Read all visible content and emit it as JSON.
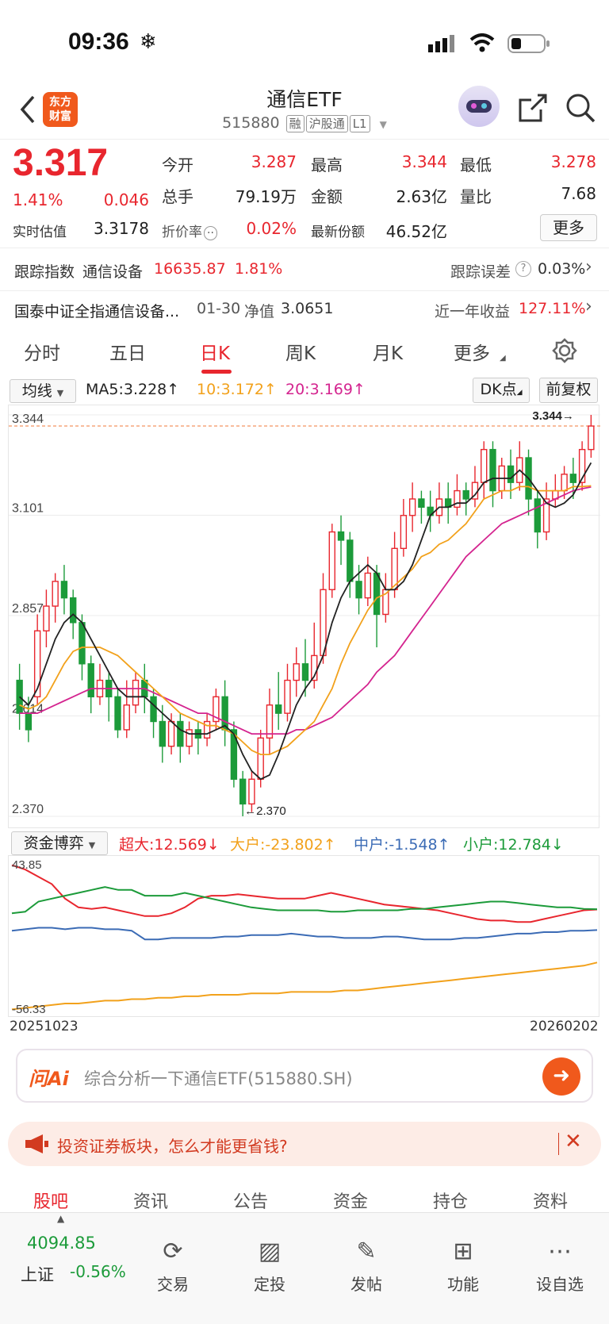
{
  "status_bar": {
    "time": "09:36"
  },
  "header": {
    "title": "通信ETF",
    "code": "515880",
    "tags": [
      "融",
      "沪股通",
      "L1"
    ],
    "logo_line1": "东方",
    "logo_line2": "财富"
  },
  "quote": {
    "price": "3.317",
    "change_pct": "1.41%",
    "change": "0.046",
    "open_label": "今开",
    "open": "3.287",
    "high_label": "最高",
    "high": "3.344",
    "low_label": "最低",
    "low": "3.278",
    "volume_label": "总手",
    "volume": "79.19万",
    "amount_label": "金额",
    "amount": "2.63亿",
    "ratio_label": "量比",
    "ratio": "7.68",
    "estimate_label": "实时估值",
    "estimate": "3.3178",
    "discount_label": "折价率",
    "discount": "0.02%",
    "shares_label": "最新份额",
    "shares": "46.52亿",
    "more_label": "更多"
  },
  "tracking": {
    "index_label": "跟踪指数",
    "index_name": "通信设备",
    "index_value": "16635.87",
    "index_change": "1.81%",
    "error_label": "跟踪误差",
    "error_value": "0.03%"
  },
  "fund": {
    "name": "国泰中证全指通信设备...",
    "date": "01-30",
    "nav_label": "净值",
    "nav": "3.0651",
    "return_label": "近一年收益",
    "return_value": "127.11%"
  },
  "tabs": [
    "分时",
    "五日",
    "日K",
    "周K",
    "月K",
    "更多"
  ],
  "indicators": {
    "ma_select": "均线",
    "ma5": "MA5:3.228↑",
    "ma10": "10:3.172↑",
    "ma20": "20:3.169↑",
    "dk": "DK点",
    "adjust": "前复权"
  },
  "main_chart": {
    "y_labels": [
      "3.344",
      "3.101",
      "2.857",
      "2.614",
      "2.370"
    ],
    "high_marker": "3.344→",
    "low_marker": "←2.370"
  },
  "sub_chart": {
    "select": "资金博弈",
    "super": "超大:12.569↓",
    "large": "大户:-23.802↑",
    "medium": "中户:-1.548↑",
    "small": "小户:12.784↓",
    "y_top": "43.85",
    "y_bottom": "-56.33",
    "date_start": "20251023",
    "date_end": "20260202"
  },
  "chart_data": [
    {
      "type": "candlestick",
      "title": "",
      "ylim": [
        2.37,
        3.344
      ],
      "ticks": [
        "3.344",
        "3.101",
        "2.857",
        "2.614",
        "2.370"
      ],
      "candles": [
        [
          2.7,
          2.62,
          2.74,
          2.58
        ],
        [
          2.62,
          2.58,
          2.66,
          2.55
        ],
        [
          2.66,
          2.82,
          2.86,
          2.64
        ],
        [
          2.82,
          2.88,
          2.92,
          2.78
        ],
        [
          2.88,
          2.94,
          2.96,
          2.84
        ],
        [
          2.94,
          2.9,
          2.98,
          2.86
        ],
        [
          2.9,
          2.84,
          2.92,
          2.8
        ],
        [
          2.84,
          2.74,
          2.86,
          2.7
        ],
        [
          2.74,
          2.66,
          2.76,
          2.62
        ],
        [
          2.66,
          2.7,
          2.74,
          2.64
        ],
        [
          2.7,
          2.66,
          2.72,
          2.6
        ],
        [
          2.66,
          2.58,
          2.68,
          2.56
        ],
        [
          2.58,
          2.64,
          2.7,
          2.56
        ],
        [
          2.64,
          2.7,
          2.72,
          2.62
        ],
        [
          2.7,
          2.66,
          2.74,
          2.62
        ],
        [
          2.66,
          2.6,
          2.68,
          2.56
        ],
        [
          2.6,
          2.54,
          2.64,
          2.5
        ],
        [
          2.54,
          2.6,
          2.62,
          2.52
        ],
        [
          2.6,
          2.54,
          2.62,
          2.5
        ],
        [
          2.54,
          2.58,
          2.6,
          2.52
        ],
        [
          2.58,
          2.56,
          2.6,
          2.52
        ],
        [
          2.56,
          2.6,
          2.62,
          2.54
        ],
        [
          2.6,
          2.66,
          2.68,
          2.58
        ],
        [
          2.66,
          2.58,
          2.7,
          2.54
        ],
        [
          2.58,
          2.46,
          2.6,
          2.44
        ],
        [
          2.46,
          2.4,
          2.48,
          2.37
        ],
        [
          2.4,
          2.46,
          2.48,
          2.38
        ],
        [
          2.46,
          2.56,
          2.58,
          2.44
        ],
        [
          2.56,
          2.64,
          2.68,
          2.52
        ],
        [
          2.64,
          2.62,
          2.72,
          2.58
        ],
        [
          2.62,
          2.7,
          2.74,
          2.6
        ],
        [
          2.7,
          2.74,
          2.78,
          2.66
        ],
        [
          2.74,
          2.7,
          2.8,
          2.66
        ],
        [
          2.7,
          2.76,
          2.84,
          2.68
        ],
        [
          2.76,
          2.92,
          2.96,
          2.74
        ],
        [
          2.92,
          3.06,
          3.08,
          2.9
        ],
        [
          3.06,
          3.04,
          3.1,
          2.98
        ],
        [
          3.04,
          2.94,
          3.06,
          2.9
        ],
        [
          2.94,
          2.9,
          2.98,
          2.86
        ],
        [
          2.9,
          2.96,
          3.0,
          2.88
        ],
        [
          2.96,
          2.86,
          2.98,
          2.78
        ],
        [
          2.86,
          2.92,
          2.96,
          2.84
        ],
        [
          2.92,
          3.02,
          3.06,
          2.9
        ],
        [
          3.02,
          3.1,
          3.14,
          3.0
        ],
        [
          3.1,
          3.14,
          3.18,
          3.06
        ],
        [
          3.14,
          3.12,
          3.16,
          3.08
        ],
        [
          3.12,
          3.1,
          3.16,
          3.06
        ],
        [
          3.1,
          3.14,
          3.18,
          3.08
        ],
        [
          3.14,
          3.12,
          3.18,
          3.08
        ],
        [
          3.12,
          3.16,
          3.2,
          3.1
        ],
        [
          3.16,
          3.14,
          3.18,
          3.1
        ],
        [
          3.14,
          3.18,
          3.22,
          3.12
        ],
        [
          3.18,
          3.26,
          3.28,
          3.14
        ],
        [
          3.26,
          3.16,
          3.28,
          3.12
        ],
        [
          3.16,
          3.22,
          3.24,
          3.14
        ],
        [
          3.22,
          3.18,
          3.26,
          3.14
        ],
        [
          3.18,
          3.24,
          3.28,
          3.16
        ],
        [
          3.24,
          3.14,
          3.26,
          3.1
        ],
        [
          3.14,
          3.06,
          3.16,
          3.02
        ],
        [
          3.06,
          3.14,
          3.18,
          3.04
        ],
        [
          3.14,
          3.16,
          3.2,
          3.12
        ],
        [
          3.16,
          3.2,
          3.22,
          3.14
        ],
        [
          3.2,
          3.18,
          3.24,
          3.14
        ],
        [
          3.18,
          3.26,
          3.28,
          3.16
        ],
        [
          3.26,
          3.317,
          3.344,
          3.24
        ]
      ],
      "ma5": [
        2.66,
        2.64,
        2.68,
        2.74,
        2.8,
        2.84,
        2.86,
        2.84,
        2.8,
        2.76,
        2.72,
        2.68,
        2.66,
        2.66,
        2.66,
        2.64,
        2.62,
        2.6,
        2.58,
        2.57,
        2.57,
        2.57,
        2.58,
        2.59,
        2.57,
        2.52,
        2.48,
        2.46,
        2.47,
        2.52,
        2.58,
        2.64,
        2.68,
        2.71,
        2.76,
        2.84,
        2.9,
        2.94,
        2.96,
        2.98,
        2.96,
        2.92,
        2.92,
        2.94,
        2.98,
        3.04,
        3.1,
        3.12,
        3.12,
        3.13,
        3.13,
        3.15,
        3.18,
        3.19,
        3.19,
        3.19,
        3.21,
        3.19,
        3.16,
        3.13,
        3.12,
        3.13,
        3.15,
        3.19,
        3.228
      ],
      "ma10": [
        2.64,
        2.63,
        2.64,
        2.66,
        2.7,
        2.74,
        2.77,
        2.78,
        2.78,
        2.78,
        2.77,
        2.76,
        2.74,
        2.72,
        2.7,
        2.68,
        2.66,
        2.64,
        2.62,
        2.61,
        2.6,
        2.59,
        2.59,
        2.58,
        2.57,
        2.55,
        2.53,
        2.52,
        2.52,
        2.53,
        2.54,
        2.56,
        2.58,
        2.6,
        2.64,
        2.68,
        2.74,
        2.79,
        2.83,
        2.87,
        2.9,
        2.91,
        2.93,
        2.95,
        2.97,
        3.0,
        3.01,
        3.03,
        3.04,
        3.06,
        3.08,
        3.11,
        3.14,
        3.15,
        3.16,
        3.16,
        3.17,
        3.17,
        3.16,
        3.16,
        3.16,
        3.16,
        3.17,
        3.17,
        3.172
      ],
      "ma20": [
        2.62,
        2.62,
        2.62,
        2.63,
        2.64,
        2.65,
        2.66,
        2.67,
        2.68,
        2.68,
        2.68,
        2.68,
        2.68,
        2.68,
        2.68,
        2.67,
        2.66,
        2.65,
        2.64,
        2.63,
        2.62,
        2.62,
        2.61,
        2.6,
        2.59,
        2.58,
        2.57,
        2.57,
        2.57,
        2.57,
        2.57,
        2.58,
        2.58,
        2.59,
        2.6,
        2.61,
        2.63,
        2.65,
        2.67,
        2.69,
        2.72,
        2.74,
        2.76,
        2.79,
        2.82,
        2.85,
        2.88,
        2.91,
        2.94,
        2.97,
        3.0,
        3.02,
        3.04,
        3.06,
        3.08,
        3.09,
        3.1,
        3.11,
        3.12,
        3.13,
        3.14,
        3.15,
        3.16,
        3.165,
        3.169
      ]
    },
    {
      "type": "line",
      "title": "",
      "ylim": [
        -56.33,
        43.85
      ],
      "series": [
        {
          "name": "超大",
          "color": "#e8262e",
          "values": [
            43,
            40,
            35,
            30,
            20,
            14,
            13,
            14,
            12,
            10,
            8,
            8,
            10,
            14,
            20,
            22,
            22,
            23,
            22,
            21,
            20,
            20,
            20,
            22,
            24,
            22,
            20,
            18,
            16,
            15,
            14,
            13,
            12,
            10,
            8,
            6,
            5,
            5,
            4,
            4,
            6,
            8,
            10,
            12,
            12.569
          ]
        },
        {
          "name": "大户",
          "color": "#f2a11b",
          "values": [
            -56,
            -55,
            -54,
            -53,
            -52,
            -52,
            -51,
            -50,
            -50,
            -49,
            -49,
            -48,
            -48,
            -47,
            -47,
            -46,
            -46,
            -46,
            -45,
            -45,
            -45,
            -44,
            -44,
            -44,
            -44,
            -43,
            -43,
            -42,
            -41,
            -40,
            -39,
            -38,
            -37,
            -36,
            -35,
            -34,
            -33,
            -32,
            -31,
            -30,
            -29,
            -28,
            -27,
            -26,
            -23.802
          ]
        },
        {
          "name": "中户",
          "color": "#3b6bb5",
          "values": [
            -2,
            -1,
            0,
            0,
            -1,
            0,
            0,
            -1,
            -1,
            -2,
            -8,
            -8,
            -7,
            -7,
            -7,
            -7,
            -6,
            -6,
            -5,
            -5,
            -5,
            -4,
            -5,
            -6,
            -6,
            -7,
            -7,
            -7,
            -6,
            -6,
            -7,
            -8,
            -8,
            -8,
            -7,
            -7,
            -6,
            -5,
            -4,
            -4,
            -3,
            -3,
            -2,
            -2,
            -1.548
          ]
        },
        {
          "name": "小户",
          "color": "#1c9b3a",
          "values": [
            10,
            11,
            18,
            20,
            22,
            24,
            26,
            28,
            26,
            26,
            22,
            22,
            22,
            24,
            22,
            20,
            18,
            16,
            14,
            13,
            12,
            12,
            12,
            12,
            11,
            11,
            12,
            12,
            12,
            12,
            13,
            13,
            14,
            15,
            16,
            17,
            18,
            18,
            17,
            16,
            15,
            14,
            14,
            13,
            12.784
          ]
        }
      ]
    }
  ],
  "ai": {
    "logo": "问Ai",
    "placeholder": "综合分析一下通信ETF(515880.SH)"
  },
  "notice": {
    "text": "投资证券板块，怎么才能更省钱?"
  },
  "community_tabs": [
    "股吧",
    "资讯",
    "公告",
    "资金",
    "持仓",
    "资料"
  ],
  "bottom": {
    "index_value": "4094.85",
    "index_name": "上证",
    "index_change": "-0.56%",
    "items": [
      "交易",
      "定投",
      "发帖",
      "功能",
      "设自选"
    ]
  }
}
